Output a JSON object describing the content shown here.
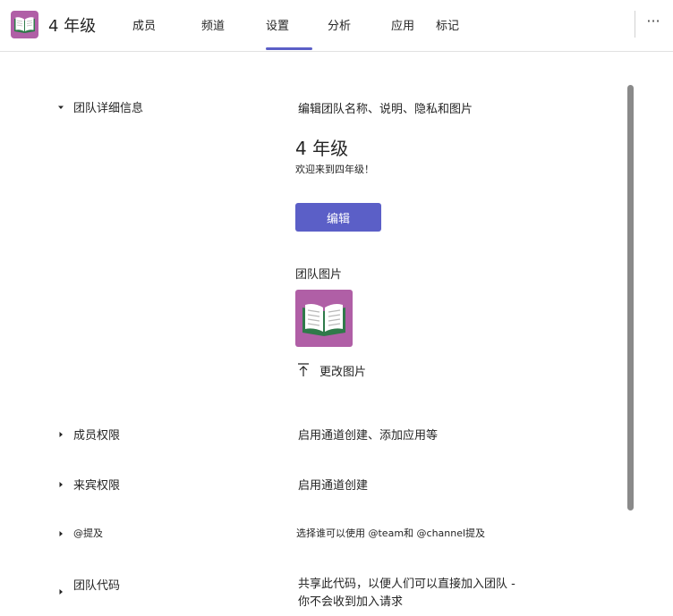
{
  "header": {
    "team_name": "4 年级",
    "tabs": [
      {
        "label": "成员"
      },
      {
        "label": "频道"
      },
      {
        "label": "设置",
        "selected": true
      },
      {
        "label": "分析"
      },
      {
        "label": "应用"
      },
      {
        "label": "标记"
      }
    ],
    "more_icon": "more-horizontal-icon",
    "more_glyph": "···",
    "accent_color": "#5b5fc7",
    "avatar_color": "#b05fa6"
  },
  "sections": {
    "team_details": {
      "label": "团队详细信息",
      "expanded": true,
      "description": "编辑团队名称、说明、隐私和图片",
      "team_name": "4 年级",
      "team_description": "欢迎来到四年级！",
      "edit_label": "编辑",
      "picture_label": "团队图片",
      "picture_icon": "book-icon",
      "change_picture_label": "更改图片",
      "upload_icon": "arrow-up-icon"
    },
    "member_permissions": {
      "label": "成员权限",
      "description": "启用通道创建、添加应用等"
    },
    "guest_permissions": {
      "label": "来宾权限",
      "description": "启用通道创建"
    },
    "mentions": {
      "label": "@提及",
      "description": "选择谁可以使用 @team和 @channel提及"
    },
    "team_code": {
      "label": "团队代码",
      "description_line1": "共享此代码，以便人们可以直接加入团队 -",
      "description_line2": "你不会收到加入请求"
    }
  }
}
